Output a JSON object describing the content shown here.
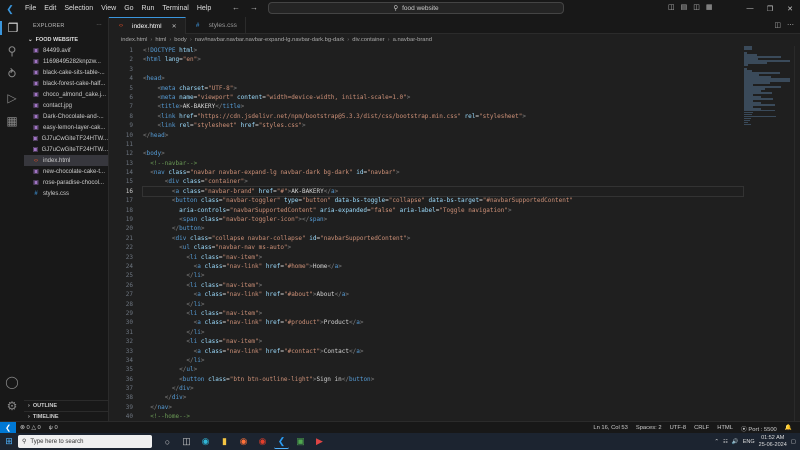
{
  "menu": [
    "File",
    "Edit",
    "Selection",
    "View",
    "Go",
    "Run",
    "Terminal",
    "Help"
  ],
  "command_center": "food website",
  "explorer_title": "EXPLORER",
  "folder_name": "FOOD WEBSITE",
  "files": [
    {
      "name": "84499.avif",
      "type": "img"
    },
    {
      "name": "1169849528​2knpzw...",
      "type": "img"
    },
    {
      "name": "black-cake-sits-table-...",
      "type": "img"
    },
    {
      "name": "black-forest-cake-half...",
      "type": "img"
    },
    {
      "name": "choco_almond_cake.j...",
      "type": "img"
    },
    {
      "name": "contact.jpg",
      "type": "img"
    },
    {
      "name": "Dark-Chocolate-and-...",
      "type": "img"
    },
    {
      "name": "easy-lemon-layer-cak...",
      "type": "img"
    },
    {
      "name": "GJ7uCwGiteTF24HTW...",
      "type": "img"
    },
    {
      "name": "GJ7uCwGiteTF24HTW...",
      "type": "img"
    },
    {
      "name": "index.html",
      "type": "html",
      "selected": true
    },
    {
      "name": "new-chocolate-cake-t...",
      "type": "img"
    },
    {
      "name": "rose-paradise-chocol...",
      "type": "img"
    },
    {
      "name": "styles.css",
      "type": "css"
    }
  ],
  "outline_label": "OUTLINE",
  "timeline_label": "TIMELINE",
  "tabs": [
    {
      "label": "index.html",
      "active": true,
      "type": "html"
    },
    {
      "label": "styles.css",
      "active": false,
      "type": "css"
    }
  ],
  "breadcrumb": [
    "index.html",
    "html",
    "body",
    "nav#navbar.navbar.navbar-expand-lg.navbar-dark.bg-dark",
    "div.container",
    "a.navbar-brand"
  ],
  "current_line": 16,
  "code_lines": [
    [
      [
        "t-br",
        "<!"
      ],
      [
        "t-tag",
        "DOCTYPE"
      ],
      [
        "t-txt",
        " "
      ],
      [
        "t-attr",
        "html"
      ],
      [
        "t-br",
        ">"
      ]
    ],
    [
      [
        "t-br",
        "<"
      ],
      [
        "t-tag",
        "html"
      ],
      [
        "t-txt",
        " "
      ],
      [
        "t-attr",
        "lang"
      ],
      [
        "t-txt",
        "="
      ],
      [
        "t-str",
        "\"en\""
      ],
      [
        "t-br",
        ">"
      ]
    ],
    [],
    [
      [
        "t-br",
        "<"
      ],
      [
        "t-tag",
        "head"
      ],
      [
        "t-br",
        ">"
      ]
    ],
    [
      [
        "t-txt",
        "    "
      ],
      [
        "t-br",
        "<"
      ],
      [
        "t-tag",
        "meta"
      ],
      [
        "t-txt",
        " "
      ],
      [
        "t-attr",
        "charset"
      ],
      [
        "t-txt",
        "="
      ],
      [
        "t-str",
        "\"UTF-8\""
      ],
      [
        "t-br",
        ">"
      ]
    ],
    [
      [
        "t-txt",
        "    "
      ],
      [
        "t-br",
        "<"
      ],
      [
        "t-tag",
        "meta"
      ],
      [
        "t-txt",
        " "
      ],
      [
        "t-attr",
        "name"
      ],
      [
        "t-txt",
        "="
      ],
      [
        "t-str",
        "\"viewport\""
      ],
      [
        "t-txt",
        " "
      ],
      [
        "t-attr",
        "content"
      ],
      [
        "t-txt",
        "="
      ],
      [
        "t-str",
        "\"width=device-width, initial-scale=1.0\""
      ],
      [
        "t-br",
        ">"
      ]
    ],
    [
      [
        "t-txt",
        "    "
      ],
      [
        "t-br",
        "<"
      ],
      [
        "t-tag",
        "title"
      ],
      [
        "t-br",
        ">"
      ],
      [
        "t-txt",
        "AK-BAKERY"
      ],
      [
        "t-br",
        "</"
      ],
      [
        "t-tag",
        "title"
      ],
      [
        "t-br",
        ">"
      ]
    ],
    [
      [
        "t-txt",
        "    "
      ],
      [
        "t-br",
        "<"
      ],
      [
        "t-tag",
        "link"
      ],
      [
        "t-txt",
        " "
      ],
      [
        "t-attr",
        "href"
      ],
      [
        "t-txt",
        "="
      ],
      [
        "t-str",
        "\"https://cdn.jsdelivr.net/npm/bootstrap@5.3.3/dist/css/bootstrap.min.css\""
      ],
      [
        "t-txt",
        " "
      ],
      [
        "t-attr",
        "rel"
      ],
      [
        "t-txt",
        "="
      ],
      [
        "t-str",
        "\"stylesheet\""
      ],
      [
        "t-br",
        ">"
      ]
    ],
    [
      [
        "t-txt",
        "    "
      ],
      [
        "t-br",
        "<"
      ],
      [
        "t-tag",
        "link"
      ],
      [
        "t-txt",
        " "
      ],
      [
        "t-attr",
        "rel"
      ],
      [
        "t-txt",
        "="
      ],
      [
        "t-str",
        "\"stylesheet\""
      ],
      [
        "t-txt",
        " "
      ],
      [
        "t-attr",
        "href"
      ],
      [
        "t-txt",
        "="
      ],
      [
        "t-str",
        "\"styles.css\""
      ],
      [
        "t-br",
        ">"
      ]
    ],
    [
      [
        "t-br",
        "</"
      ],
      [
        "t-tag",
        "head"
      ],
      [
        "t-br",
        ">"
      ]
    ],
    [],
    [
      [
        "t-br",
        "<"
      ],
      [
        "t-tag",
        "body"
      ],
      [
        "t-br",
        ">"
      ]
    ],
    [
      [
        "t-txt",
        "  "
      ],
      [
        "t-com",
        "<!--navbar-->"
      ]
    ],
    [
      [
        "t-txt",
        "  "
      ],
      [
        "t-br",
        "<"
      ],
      [
        "t-tag",
        "nav"
      ],
      [
        "t-txt",
        " "
      ],
      [
        "t-attr",
        "class"
      ],
      [
        "t-txt",
        "="
      ],
      [
        "t-str",
        "\"navbar navbar-expand-lg navbar-dark bg-dark\""
      ],
      [
        "t-txt",
        " "
      ],
      [
        "t-attr",
        "id"
      ],
      [
        "t-txt",
        "="
      ],
      [
        "t-str",
        "\"navbar\""
      ],
      [
        "t-br",
        ">"
      ]
    ],
    [
      [
        "t-txt",
        "      "
      ],
      [
        "t-br",
        "<"
      ],
      [
        "t-tag",
        "div"
      ],
      [
        "t-txt",
        " "
      ],
      [
        "t-attr",
        "class"
      ],
      [
        "t-txt",
        "="
      ],
      [
        "t-str",
        "\"container\""
      ],
      [
        "t-br",
        ">"
      ]
    ],
    [
      [
        "t-txt",
        "        "
      ],
      [
        "t-br",
        "<"
      ],
      [
        "t-tag",
        "a"
      ],
      [
        "t-txt",
        " "
      ],
      [
        "t-attr",
        "class"
      ],
      [
        "t-txt",
        "="
      ],
      [
        "t-str",
        "\"navbar-brand\""
      ],
      [
        "t-txt",
        " "
      ],
      [
        "t-attr",
        "href"
      ],
      [
        "t-txt",
        "="
      ],
      [
        "t-str",
        "\"#\""
      ],
      [
        "t-br",
        ">"
      ],
      [
        "t-txt",
        "AK-BAKERY"
      ],
      [
        "t-br",
        "</"
      ],
      [
        "t-tag",
        "a"
      ],
      [
        "t-br",
        ">"
      ]
    ],
    [
      [
        "t-txt",
        "        "
      ],
      [
        "t-br",
        "<"
      ],
      [
        "t-tag",
        "button"
      ],
      [
        "t-txt",
        " "
      ],
      [
        "t-attr",
        "class"
      ],
      [
        "t-txt",
        "="
      ],
      [
        "t-str",
        "\"navbar-toggler\""
      ],
      [
        "t-txt",
        " "
      ],
      [
        "t-attr",
        "type"
      ],
      [
        "t-txt",
        "="
      ],
      [
        "t-str",
        "\"button\""
      ],
      [
        "t-txt",
        " "
      ],
      [
        "t-attr",
        "data-bs-toggle"
      ],
      [
        "t-txt",
        "="
      ],
      [
        "t-str",
        "\"collapse\""
      ],
      [
        "t-txt",
        " "
      ],
      [
        "t-attr",
        "data-bs-target"
      ],
      [
        "t-txt",
        "="
      ],
      [
        "t-str",
        "\"#navbarSupportedContent\""
      ]
    ],
    [
      [
        "t-txt",
        "          "
      ],
      [
        "t-attr",
        "aria-controls"
      ],
      [
        "t-txt",
        "="
      ],
      [
        "t-str",
        "\"navbarSupportedContent\""
      ],
      [
        "t-txt",
        " "
      ],
      [
        "t-attr",
        "aria-expanded"
      ],
      [
        "t-txt",
        "="
      ],
      [
        "t-str",
        "\"false\""
      ],
      [
        "t-txt",
        " "
      ],
      [
        "t-attr",
        "aria-label"
      ],
      [
        "t-txt",
        "="
      ],
      [
        "t-str",
        "\"Toggle navigation\""
      ],
      [
        "t-br",
        ">"
      ]
    ],
    [
      [
        "t-txt",
        "          "
      ],
      [
        "t-br",
        "<"
      ],
      [
        "t-tag",
        "span"
      ],
      [
        "t-txt",
        " "
      ],
      [
        "t-attr",
        "class"
      ],
      [
        "t-txt",
        "="
      ],
      [
        "t-str",
        "\"navbar-toggler-icon\""
      ],
      [
        "t-br",
        "></"
      ],
      [
        "t-tag",
        "span"
      ],
      [
        "t-br",
        ">"
      ]
    ],
    [
      [
        "t-txt",
        "        "
      ],
      [
        "t-br",
        "</"
      ],
      [
        "t-tag",
        "button"
      ],
      [
        "t-br",
        ">"
      ]
    ],
    [
      [
        "t-txt",
        "        "
      ],
      [
        "t-br",
        "<"
      ],
      [
        "t-tag",
        "div"
      ],
      [
        "t-txt",
        " "
      ],
      [
        "t-attr",
        "class"
      ],
      [
        "t-txt",
        "="
      ],
      [
        "t-str",
        "\"collapse navbar-collapse\""
      ],
      [
        "t-txt",
        " "
      ],
      [
        "t-attr",
        "id"
      ],
      [
        "t-txt",
        "="
      ],
      [
        "t-str",
        "\"navbarSupportedContent\""
      ],
      [
        "t-br",
        ">"
      ]
    ],
    [
      [
        "t-txt",
        "          "
      ],
      [
        "t-br",
        "<"
      ],
      [
        "t-tag",
        "ul"
      ],
      [
        "t-txt",
        " "
      ],
      [
        "t-attr",
        "class"
      ],
      [
        "t-txt",
        "="
      ],
      [
        "t-str",
        "\"navbar-nav ms-auto\""
      ],
      [
        "t-br",
        ">"
      ]
    ],
    [
      [
        "t-txt",
        "            "
      ],
      [
        "t-br",
        "<"
      ],
      [
        "t-tag",
        "li"
      ],
      [
        "t-txt",
        " "
      ],
      [
        "t-attr",
        "class"
      ],
      [
        "t-txt",
        "="
      ],
      [
        "t-str",
        "\"nav-item\""
      ],
      [
        "t-br",
        ">"
      ]
    ],
    [
      [
        "t-txt",
        "              "
      ],
      [
        "t-br",
        "<"
      ],
      [
        "t-tag",
        "a"
      ],
      [
        "t-txt",
        " "
      ],
      [
        "t-attr",
        "class"
      ],
      [
        "t-txt",
        "="
      ],
      [
        "t-str",
        "\"nav-link\""
      ],
      [
        "t-txt",
        " "
      ],
      [
        "t-attr",
        "href"
      ],
      [
        "t-txt",
        "="
      ],
      [
        "t-str",
        "\"#home\""
      ],
      [
        "t-br",
        ">"
      ],
      [
        "t-txt",
        "Home"
      ],
      [
        "t-br",
        "</"
      ],
      [
        "t-tag",
        "a"
      ],
      [
        "t-br",
        ">"
      ]
    ],
    [
      [
        "t-txt",
        "            "
      ],
      [
        "t-br",
        "</"
      ],
      [
        "t-tag",
        "li"
      ],
      [
        "t-br",
        ">"
      ]
    ],
    [
      [
        "t-txt",
        "            "
      ],
      [
        "t-br",
        "<"
      ],
      [
        "t-tag",
        "li"
      ],
      [
        "t-txt",
        " "
      ],
      [
        "t-attr",
        "class"
      ],
      [
        "t-txt",
        "="
      ],
      [
        "t-str",
        "\"nav-item\""
      ],
      [
        "t-br",
        ">"
      ]
    ],
    [
      [
        "t-txt",
        "              "
      ],
      [
        "t-br",
        "<"
      ],
      [
        "t-tag",
        "a"
      ],
      [
        "t-txt",
        " "
      ],
      [
        "t-attr",
        "class"
      ],
      [
        "t-txt",
        "="
      ],
      [
        "t-str",
        "\"nav-link\""
      ],
      [
        "t-txt",
        " "
      ],
      [
        "t-attr",
        "href"
      ],
      [
        "t-txt",
        "="
      ],
      [
        "t-str",
        "\"#about\""
      ],
      [
        "t-br",
        ">"
      ],
      [
        "t-txt",
        "About"
      ],
      [
        "t-br",
        "</"
      ],
      [
        "t-tag",
        "a"
      ],
      [
        "t-br",
        ">"
      ]
    ],
    [
      [
        "t-txt",
        "            "
      ],
      [
        "t-br",
        "</"
      ],
      [
        "t-tag",
        "li"
      ],
      [
        "t-br",
        ">"
      ]
    ],
    [
      [
        "t-txt",
        "            "
      ],
      [
        "t-br",
        "<"
      ],
      [
        "t-tag",
        "li"
      ],
      [
        "t-txt",
        " "
      ],
      [
        "t-attr",
        "class"
      ],
      [
        "t-txt",
        "="
      ],
      [
        "t-str",
        "\"nav-item\""
      ],
      [
        "t-br",
        ">"
      ]
    ],
    [
      [
        "t-txt",
        "              "
      ],
      [
        "t-br",
        "<"
      ],
      [
        "t-tag",
        "a"
      ],
      [
        "t-txt",
        " "
      ],
      [
        "t-attr",
        "class"
      ],
      [
        "t-txt",
        "="
      ],
      [
        "t-str",
        "\"nav-link\""
      ],
      [
        "t-txt",
        " "
      ],
      [
        "t-attr",
        "href"
      ],
      [
        "t-txt",
        "="
      ],
      [
        "t-str",
        "\"#product\""
      ],
      [
        "t-br",
        ">"
      ],
      [
        "t-txt",
        "Product"
      ],
      [
        "t-br",
        "</"
      ],
      [
        "t-tag",
        "a"
      ],
      [
        "t-br",
        ">"
      ]
    ],
    [
      [
        "t-txt",
        "            "
      ],
      [
        "t-br",
        "</"
      ],
      [
        "t-tag",
        "li"
      ],
      [
        "t-br",
        ">"
      ]
    ],
    [
      [
        "t-txt",
        "            "
      ],
      [
        "t-br",
        "<"
      ],
      [
        "t-tag",
        "li"
      ],
      [
        "t-txt",
        " "
      ],
      [
        "t-attr",
        "class"
      ],
      [
        "t-txt",
        "="
      ],
      [
        "t-str",
        "\"nav-item\""
      ],
      [
        "t-br",
        ">"
      ]
    ],
    [
      [
        "t-txt",
        "              "
      ],
      [
        "t-br",
        "<"
      ],
      [
        "t-tag",
        "a"
      ],
      [
        "t-txt",
        " "
      ],
      [
        "t-attr",
        "class"
      ],
      [
        "t-txt",
        "="
      ],
      [
        "t-str",
        "\"nav-link\""
      ],
      [
        "t-txt",
        " "
      ],
      [
        "t-attr",
        "href"
      ],
      [
        "t-txt",
        "="
      ],
      [
        "t-str",
        "\"#contact\""
      ],
      [
        "t-br",
        ">"
      ],
      [
        "t-txt",
        "Contact"
      ],
      [
        "t-br",
        "</"
      ],
      [
        "t-tag",
        "a"
      ],
      [
        "t-br",
        ">"
      ]
    ],
    [
      [
        "t-txt",
        "            "
      ],
      [
        "t-br",
        "</"
      ],
      [
        "t-tag",
        "li"
      ],
      [
        "t-br",
        ">"
      ]
    ],
    [
      [
        "t-txt",
        "          "
      ],
      [
        "t-br",
        "</"
      ],
      [
        "t-tag",
        "ul"
      ],
      [
        "t-br",
        ">"
      ]
    ],
    [
      [
        "t-txt",
        "          "
      ],
      [
        "t-br",
        "<"
      ],
      [
        "t-tag",
        "button"
      ],
      [
        "t-txt",
        " "
      ],
      [
        "t-attr",
        "class"
      ],
      [
        "t-txt",
        "="
      ],
      [
        "t-str",
        "\"btn btn-outline-light\""
      ],
      [
        "t-br",
        ">"
      ],
      [
        "t-txt",
        "Sign in"
      ],
      [
        "t-br",
        "</"
      ],
      [
        "t-tag",
        "button"
      ],
      [
        "t-br",
        ">"
      ]
    ],
    [
      [
        "t-txt",
        "        "
      ],
      [
        "t-br",
        "</"
      ],
      [
        "t-tag",
        "div"
      ],
      [
        "t-br",
        ">"
      ]
    ],
    [
      [
        "t-txt",
        "      "
      ],
      [
        "t-br",
        "</"
      ],
      [
        "t-tag",
        "div"
      ],
      [
        "t-br",
        ">"
      ]
    ],
    [
      [
        "t-txt",
        "  "
      ],
      [
        "t-br",
        "</"
      ],
      [
        "t-tag",
        "nav"
      ],
      [
        "t-br",
        ">"
      ]
    ],
    [
      [
        "t-txt",
        "  "
      ],
      [
        "t-com",
        "<!--home-->"
      ]
    ]
  ],
  "status": {
    "errors": "0",
    "warnings": "0",
    "ports": "0",
    "position": "Ln 16, Col 53",
    "spaces": "Spaces: 2",
    "encoding": "UTF-8",
    "eol": "CRLF",
    "language": "HTML",
    "port": "Port : 5500"
  },
  "taskbar": {
    "search_placeholder": "Type here to search",
    "lang": "ENG",
    "time": "01:52 AM",
    "date": "25-06-2024"
  },
  "colors": {
    "accent": "#0078d4",
    "tag": "#569cd6",
    "attr": "#9cdcfe",
    "string": "#ce9178",
    "comment": "#6a9955"
  }
}
